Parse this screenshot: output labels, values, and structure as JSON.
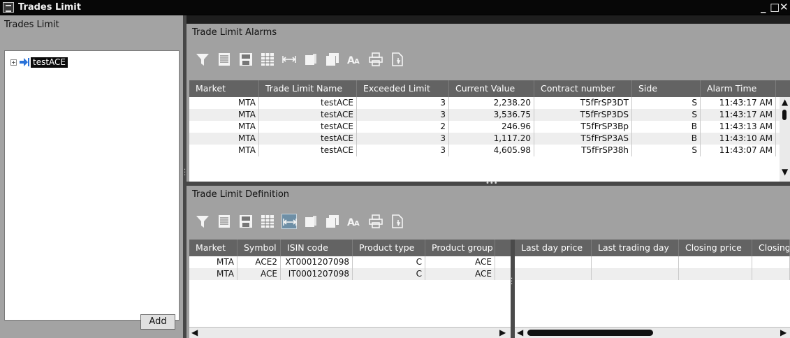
{
  "window": {
    "title": "Trades Limit",
    "controls": [
      "_",
      "□",
      "✕"
    ]
  },
  "left_panel": {
    "header": "Trades Limit",
    "tree_items": [
      {
        "label": "testACE"
      }
    ],
    "add_label": "Add"
  },
  "alarms": {
    "title": "Trade Limit Alarms",
    "columns": [
      "Market",
      "Trade Limit Name",
      "Exceeded Limit",
      "Current Value",
      "Contract number",
      "Side",
      "Alarm Time"
    ],
    "rows": [
      [
        "MTA",
        "testACE",
        "3",
        "2,238.20",
        "T5fFrSP3DT",
        "S",
        "11:43:17 AM"
      ],
      [
        "MTA",
        "testACE",
        "3",
        "3,536.75",
        "T5fFrSP3DS",
        "S",
        "11:43:17 AM"
      ],
      [
        "MTA",
        "testACE",
        "2",
        "246.96",
        "T5fFrSP3Bp",
        "B",
        "11:43:13 AM"
      ],
      [
        "MTA",
        "testACE",
        "3",
        "1,117.20",
        "T5fFrSP3AS",
        "B",
        "11:43:10 AM"
      ],
      [
        "MTA",
        "testACE",
        "3",
        "4,605.98",
        "T5fFrSP38h",
        "S",
        "11:43:07 AM"
      ]
    ]
  },
  "definition": {
    "title": "Trade Limit Definition",
    "left_columns": [
      "Market",
      "Symbol",
      "ISIN code",
      "Product type",
      "Product group"
    ],
    "right_columns": [
      "Last day price",
      "Last trading day",
      "Closing price",
      "Closing"
    ],
    "rows": [
      [
        "MTA",
        "ACE2",
        "XT0001207098",
        "C",
        "ACE"
      ],
      [
        "MTA",
        "ACE",
        "IT0001207098",
        "C",
        "ACE"
      ]
    ]
  },
  "toolbar_icons": [
    "filter-icon",
    "list-icon",
    "save-icon",
    "columns-icon",
    "fit-width-icon",
    "copy-icon",
    "copy-all-icon",
    "font-size-icon",
    "print-icon",
    "export-icon"
  ],
  "colors": {
    "panel_bg": "#a1a1a1",
    "header_bg": "#636363",
    "title_bar": "#070707",
    "active_tool": "#6e8fa6"
  }
}
